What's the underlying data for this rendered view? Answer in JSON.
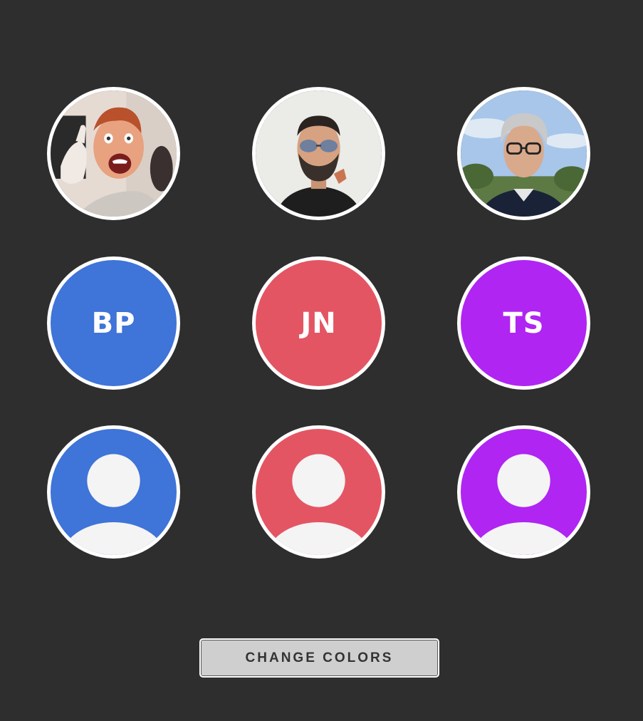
{
  "photos": [
    {
      "name": "excited-man-thumbs-up",
      "bg": "#e8ddd6"
    },
    {
      "name": "bearded-man-sunglasses",
      "bg": "#e9e9e5"
    },
    {
      "name": "older-man-glasses",
      "bg": "#a9c7e8"
    }
  ],
  "initial_avatars": [
    {
      "initials": "BP",
      "color": "#3f74d8"
    },
    {
      "initials": "JN",
      "color": "#e45563"
    },
    {
      "initials": "TS",
      "color": "#b025f2"
    }
  ],
  "placeholder_avatars": [
    {
      "icon": "person-icon",
      "color": "#3f74d8"
    },
    {
      "icon": "person-icon",
      "color": "#e45563"
    },
    {
      "icon": "person-icon",
      "color": "#b025f2"
    }
  ],
  "button": {
    "label": "CHANGE COLORS"
  }
}
